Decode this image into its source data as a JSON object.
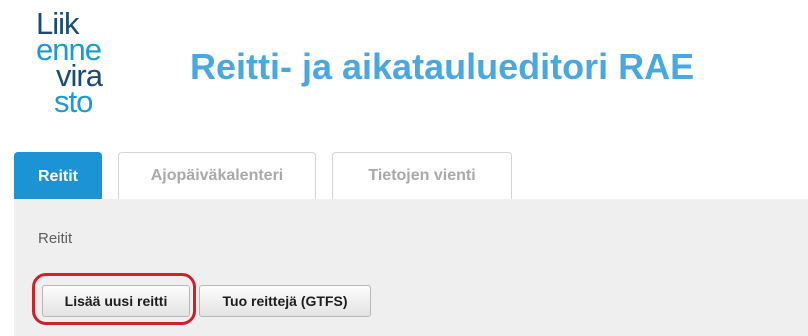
{
  "logo": {
    "lines": [
      "Liik",
      "enne",
      "vira",
      "sto"
    ]
  },
  "header": {
    "title": "Reitti- ja aikataulueditori RAE"
  },
  "tabs": [
    {
      "label": "Reitit",
      "active": true
    },
    {
      "label": "Ajopäiväkalenteri",
      "active": false
    },
    {
      "label": "Tietojen vienti",
      "active": false
    }
  ],
  "main": {
    "section_label": "Reitit",
    "buttons": {
      "add_route": "Lisää uusi reitti",
      "import_routes": "Tuo reittejä (GTFS)"
    }
  },
  "colors": {
    "accent": "#1b93d5",
    "title": "#4aa8e0",
    "logo_dark": "#1a4a7a",
    "logo_light": "#1b9ad6",
    "highlight": "#d0212a"
  }
}
